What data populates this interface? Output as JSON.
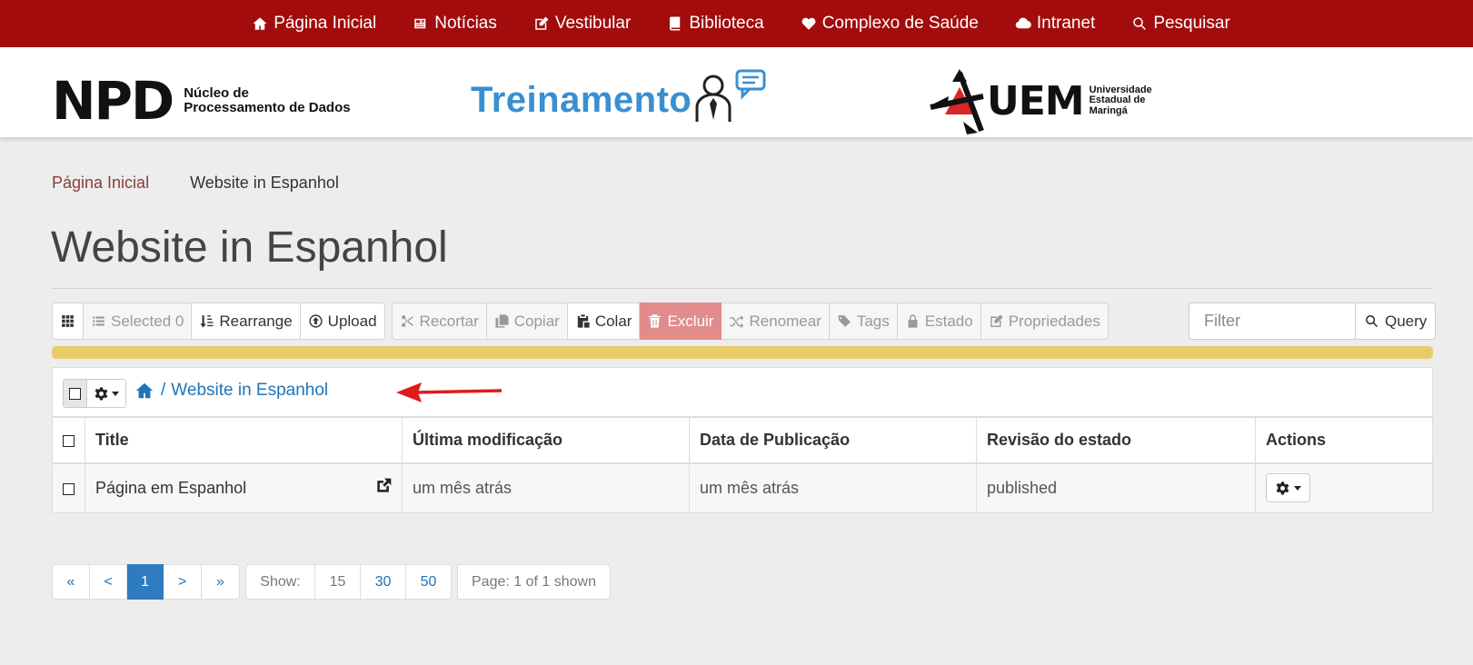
{
  "nav": {
    "items": [
      {
        "label": "Página Inicial",
        "icon": "home-icon"
      },
      {
        "label": "Notícias",
        "icon": "newspaper-icon"
      },
      {
        "label": "Vestibular",
        "icon": "edit-icon"
      },
      {
        "label": "Biblioteca",
        "icon": "book-icon"
      },
      {
        "label": "Complexo de Saúde",
        "icon": "heartbeat-icon"
      },
      {
        "label": "Intranet",
        "icon": "cloud-icon"
      },
      {
        "label": "Pesquisar",
        "icon": "search-icon"
      }
    ]
  },
  "header": {
    "npd_logo": "NPD",
    "npd_line1": "Núcleo de",
    "npd_line2": "Processamento de Dados",
    "training": "Treinamento",
    "uem_logo": "UEM",
    "uem_line1": "Universidade",
    "uem_line2": "Estadual de",
    "uem_line3": "Maringá"
  },
  "breadcrumb": {
    "home": "Página Inicial",
    "current": "Website in Espanhol"
  },
  "page_title": "Website in Espanhol",
  "toolbar": {
    "selected": "Selected 0",
    "rearrange": "Rearrange",
    "upload": "Upload",
    "cut": "Recortar",
    "copy": "Copiar",
    "paste": "Colar",
    "delete": "Excluir",
    "rename": "Renomear",
    "tags": "Tags",
    "state": "Estado",
    "properties": "Propriedades"
  },
  "filter": {
    "placeholder": "Filter",
    "query_label": "Query"
  },
  "progress": {
    "value": 1.0
  },
  "path": {
    "separator": "/",
    "folder": "Website in Espanhol"
  },
  "table": {
    "headers": {
      "title": "Title",
      "modified": "Última modificação",
      "published": "Data de Publicação",
      "review_state": "Revisão do estado",
      "actions": "Actions"
    },
    "rows": [
      {
        "title": "Página em Espanhol",
        "modified": "um mês atrás",
        "published": "um mês atrás",
        "review_state": "published"
      }
    ]
  },
  "pagination": {
    "first": "«",
    "prev": "<",
    "current": "1",
    "next": ">",
    "last": "»",
    "show_label": "Show:",
    "sizes": [
      "15",
      "30",
      "50"
    ],
    "page_info": "Page: 1 of 1 shown"
  },
  "colors": {
    "nav_bg": "#a20c0c",
    "link": "#1f74b8",
    "danger": "#e28b8b",
    "progress": "#ecd27a",
    "annotation_arrow": "#e01b1b"
  }
}
